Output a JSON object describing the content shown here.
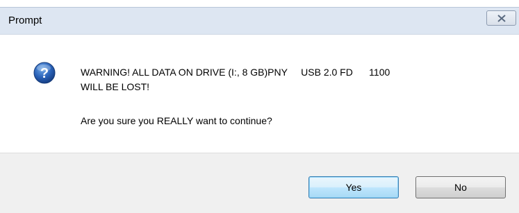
{
  "window": {
    "title": "Prompt",
    "close_icon": "close-icon"
  },
  "message": {
    "icon": "question-icon",
    "line1": "WARNING! ALL DATA ON DRIVE (I:, 8 GB)PNY     USB 2.0 FD      1100",
    "line2": "WILL BE LOST!",
    "line3": "Are you sure you REALLY want to continue?"
  },
  "buttons": {
    "yes_label": "Yes",
    "no_label": "No"
  },
  "colors": {
    "titlebar": "#dde6f2",
    "footer": "#f0f0f0",
    "default_button_border": "#3c7fb1"
  }
}
